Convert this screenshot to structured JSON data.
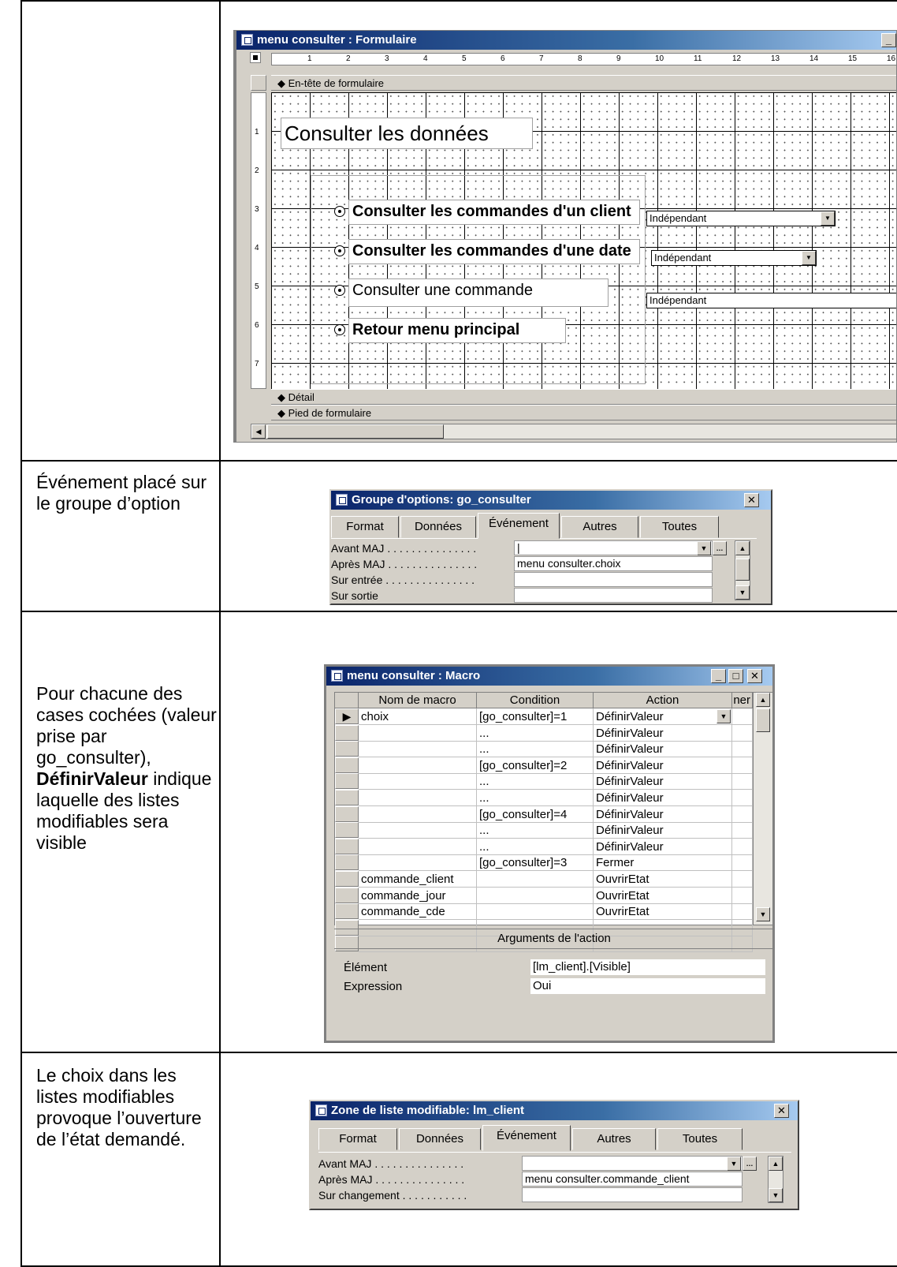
{
  "rows": [
    {
      "caption": ""
    },
    {
      "caption": "Événement placé sur le groupe d’option"
    },
    {
      "caption_html_parts": [
        "Pour chacune des cases cochées (valeur prise par go_consulter),",
        "DéfinirValeur",
        "indique laquelle des listes modifiables sera visible"
      ]
    },
    {
      "caption": "Le choix dans les listes modifiables provoque l’ouverture de l’état demandé."
    }
  ],
  "form_window": {
    "title": "menu consulter : Formulaire",
    "ruler": [
      "1",
      "2",
      "3",
      "4",
      "5",
      "6",
      "7",
      "8",
      "9",
      "10",
      "11",
      "12",
      "13",
      "14",
      "15",
      "16"
    ],
    "vruler": [
      "1",
      "2",
      "3",
      "4",
      "5",
      "6",
      "7"
    ],
    "header_section": "En-tête de formulaire",
    "detail_section": "Détail",
    "footer_section": "Pied de formulaire",
    "title_label": "Consulter les données",
    "options": [
      {
        "label": "Consulter les commandes d'un client",
        "combo": "Indépendant"
      },
      {
        "label": "Consulter les commandes d'une date",
        "combo": "Indépendant"
      },
      {
        "label": "Consulter une commande",
        "combo": "Indépendant"
      },
      {
        "label": "Retour menu principal"
      }
    ]
  },
  "props1": {
    "title": "Groupe d'options: go_consulter",
    "tabs": [
      "Format",
      "Données",
      "Événement",
      "Autres",
      "Toutes"
    ],
    "active_tab": "Événement",
    "rows": [
      {
        "label": "Avant MAJ . . . . . . . . . . . . . . .",
        "value": "|"
      },
      {
        "label": "Après MAJ . . . . . . . . . . . . . . .",
        "value": "menu consulter.choix"
      },
      {
        "label": "Sur entrée . . . . . . . . . . . . . . .",
        "value": ""
      },
      {
        "label": "Sur sortie",
        "value": ""
      }
    ]
  },
  "macro": {
    "title": "menu consulter : Macro",
    "headers": [
      "Nom de macro",
      "Condition",
      "Action",
      "ner"
    ],
    "rows": [
      [
        "choix",
        "[go_consulter]=1",
        "DéfinirValeur"
      ],
      [
        "",
        "...",
        "DéfinirValeur"
      ],
      [
        "",
        "...",
        "DéfinirValeur"
      ],
      [
        "",
        "[go_consulter]=2",
        "DéfinirValeur"
      ],
      [
        "",
        "...",
        "DéfinirValeur"
      ],
      [
        "",
        "...",
        "DéfinirValeur"
      ],
      [
        "",
        "[go_consulter]=4",
        "DéfinirValeur"
      ],
      [
        "",
        "...",
        "DéfinirValeur"
      ],
      [
        "",
        "...",
        "DéfinirValeur"
      ],
      [
        "",
        "[go_consulter]=3",
        "Fermer"
      ],
      [
        "commande_client",
        "",
        "OuvrirEtat"
      ],
      [
        "commande_jour",
        "",
        "OuvrirEtat"
      ],
      [
        "commande_cde",
        "",
        "OuvrirEtat"
      ],
      [
        "",
        "",
        ""
      ],
      [
        "",
        "",
        ""
      ]
    ],
    "args_title": "Arguments de l'action",
    "args": [
      {
        "label": "Élément",
        "value": "[lm_client].[Visible]"
      },
      {
        "label": "Expression",
        "value": "Oui"
      }
    ]
  },
  "props2": {
    "title": "Zone de liste modifiable: lm_client",
    "tabs": [
      "Format",
      "Données",
      "Événement",
      "Autres",
      "Toutes"
    ],
    "active_tab": "Événement",
    "rows": [
      {
        "label": "Avant MAJ . . . . . . . . . . . . . . .",
        "value": ""
      },
      {
        "label": "Après MAJ . . . . . . . . . . . . . . .",
        "value": "menu consulter.commande_client"
      },
      {
        "label": "Sur changement . . . . . . . . . . .",
        "value": ""
      }
    ]
  },
  "colors": {
    "titlebar": "#0a246a",
    "face": "#d4d0c8"
  }
}
